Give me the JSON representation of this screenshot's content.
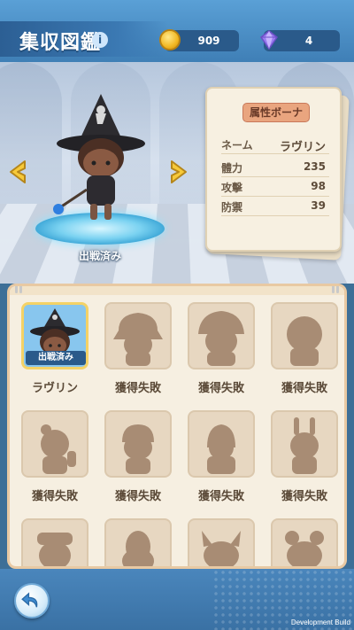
{
  "header": {
    "title": "集収図鑑",
    "info_icon": "i",
    "gold": "909",
    "gems": "4"
  },
  "showcase": {
    "deployed_label": "出戦済み",
    "left_arrow_icon": "chevron-left-icon",
    "right_arrow_icon": "chevron-right-icon"
  },
  "stats": {
    "attribute": "属性ボーナ",
    "name_key": "ネーム",
    "name_value": "ラヴリン",
    "rows": [
      {
        "key": "體力",
        "value": "235"
      },
      {
        "key": "攻擊",
        "value": "98"
      },
      {
        "key": "防禦",
        "value": "39"
      }
    ]
  },
  "collection": {
    "items": [
      {
        "label": "ラヴリン",
        "badge": "出戦済み",
        "state": "owned"
      },
      {
        "label": "獲得失敗",
        "state": "locked"
      },
      {
        "label": "獲得失敗",
        "state": "locked"
      },
      {
        "label": "獲得失敗",
        "state": "locked"
      },
      {
        "label": "獲得失敗",
        "state": "locked"
      },
      {
        "label": "獲得失敗",
        "state": "locked"
      },
      {
        "label": "獲得失敗",
        "state": "locked"
      },
      {
        "label": "獲得失敗",
        "state": "locked"
      },
      {
        "label": "",
        "state": "locked"
      },
      {
        "label": "",
        "state": "locked"
      },
      {
        "label": "",
        "state": "locked"
      },
      {
        "label": "",
        "state": "locked"
      }
    ]
  },
  "footer": {
    "dev_build": "Development Build",
    "back_icon": "back-arrow-icon"
  }
}
